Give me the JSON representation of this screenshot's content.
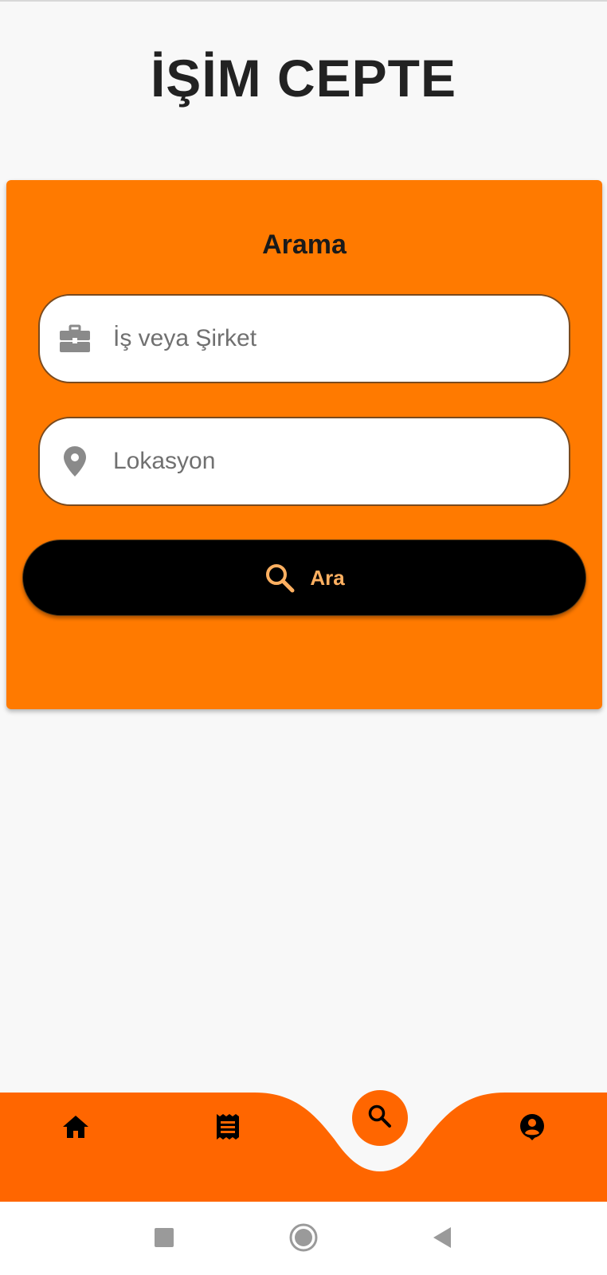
{
  "app": {
    "title": "İŞİM CEPTE"
  },
  "search_card": {
    "title": "Arama",
    "job_field": {
      "placeholder": "İş veya Şirket",
      "value": "",
      "icon": "briefcase-icon"
    },
    "location_field": {
      "placeholder": "Lokasyon",
      "value": "",
      "icon": "location-pin-icon"
    },
    "search_button": {
      "label": "Ara",
      "icon": "search-icon"
    }
  },
  "bottom_nav": {
    "items": [
      {
        "icon": "home-icon"
      },
      {
        "icon": "list-icon"
      },
      {
        "icon": "search-icon",
        "active": true
      },
      {
        "icon": "account-icon"
      }
    ]
  },
  "system_nav": {
    "items": [
      {
        "icon": "recents-square-icon"
      },
      {
        "icon": "home-circle-icon"
      },
      {
        "icon": "back-triangle-icon"
      }
    ]
  },
  "colors": {
    "accent": "#ff7a00",
    "nav_bar": "#ff6600",
    "button_bg": "#000000",
    "button_text": "#ffb061",
    "background": "#f8f8f8"
  }
}
